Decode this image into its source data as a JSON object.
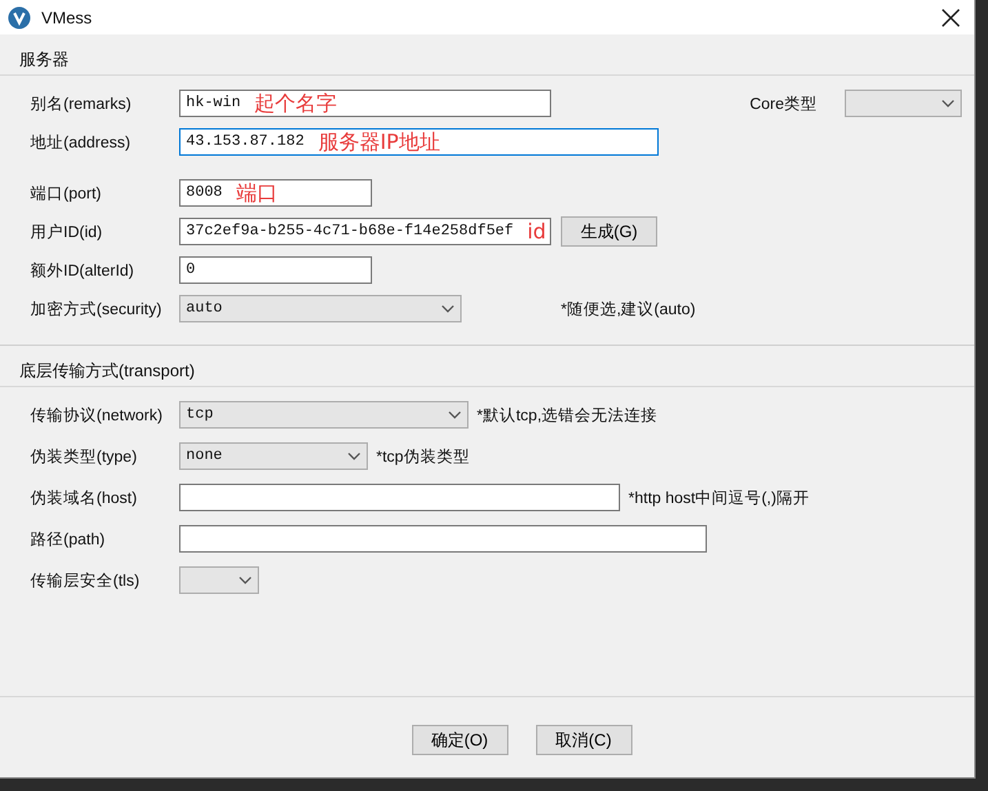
{
  "window": {
    "title": "VMess"
  },
  "sections": [
    {
      "title": "服务器",
      "rows": [
        {
          "label": "别名(remarks)",
          "kind": "text",
          "value": "hk-win",
          "annotation": "起个名字",
          "extra": {
            "label": "Core类型",
            "kind": "select"
          }
        },
        {
          "label": "地址(address)",
          "kind": "text",
          "value": "43.153.87.182",
          "annotation": "服务器IP地址",
          "focused": true
        },
        {
          "label": "端口(port)",
          "kind": "text",
          "value": "8008",
          "annotation": "端口"
        },
        {
          "label": "用户ID(id)",
          "kind": "text",
          "value": "37c2ef9a-b255-4c71-b68e-f14e258df5ef",
          "annotation": "id",
          "button": "生成(G)"
        },
        {
          "label": "额外ID(alterId)",
          "kind": "text",
          "value": "0"
        },
        {
          "label": "加密方式(security)",
          "kind": "select",
          "value": "auto",
          "note": "*随便选,建议(auto)"
        }
      ]
    },
    {
      "title": "底层传输方式(transport)",
      "rows": [
        {
          "label": "传输协议(network)",
          "kind": "select",
          "value": "tcp",
          "note": "*默认tcp,选错会无法连接"
        },
        {
          "label": "伪装类型(type)",
          "kind": "select",
          "value": "none",
          "note": "*tcp伪装类型"
        },
        {
          "label": "伪装域名(host)",
          "kind": "text",
          "note": "*http host中间逗号(,)隔开"
        },
        {
          "label": "路径(path)",
          "kind": "text"
        },
        {
          "label": "传输层安全(tls)",
          "kind": "select"
        }
      ]
    }
  ],
  "buttons": [
    "确定(O)",
    "取消(C)"
  ]
}
